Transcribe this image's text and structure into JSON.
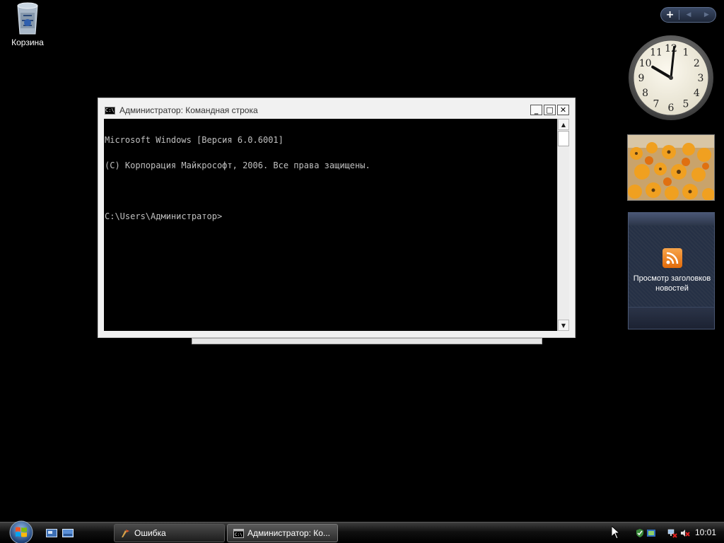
{
  "desktop": {
    "recycle_bin_label": "Корзина"
  },
  "gadgets": {
    "bar": {
      "add": "+",
      "prev": "◀",
      "next": "▶"
    },
    "clock": {
      "hour": 10,
      "minute": 1,
      "numerals": [
        "12",
        "1",
        "2",
        "3",
        "4",
        "5",
        "6",
        "7",
        "8",
        "9",
        "10",
        "11"
      ]
    },
    "feed": {
      "line1": "Просмотр заголовков",
      "line2": "новостей"
    }
  },
  "console": {
    "title": "Администратор: Командная строка",
    "icon_text": "C:\\",
    "buttons": {
      "minimize": "_",
      "maximize": "□",
      "close": "✕"
    },
    "lines": [
      "Microsoft Windows [Версия 6.0.6001]",
      "(C) Корпорация Майкрософт, 2006. Все права защищены.",
      "",
      "C:\\Users\\Администратор>"
    ],
    "scroll_up": "▲",
    "scroll_down": "▼"
  },
  "taskbar": {
    "tasks": [
      {
        "label": "Ошибка"
      },
      {
        "label": "Администратор: Ко..."
      }
    ],
    "time": "10:01"
  }
}
